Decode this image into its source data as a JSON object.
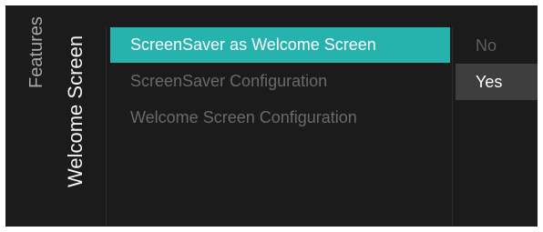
{
  "breadcrumb": {
    "parent": "Features",
    "current": "Welcome Screen"
  },
  "menu": {
    "items": [
      {
        "label": "ScreenSaver as Welcome Screen",
        "state": "selected"
      },
      {
        "label": "ScreenSaver Configuration",
        "state": "normal"
      },
      {
        "label": "Welcome Screen Configuration",
        "state": "normal"
      }
    ]
  },
  "options": {
    "items": [
      {
        "label": "No",
        "state": "normal"
      },
      {
        "label": "Yes",
        "state": "current"
      }
    ]
  },
  "colors": {
    "background": "#1b1b1b",
    "selection_accent": "#26b3ae",
    "option_highlight": "#3e3e3e"
  }
}
